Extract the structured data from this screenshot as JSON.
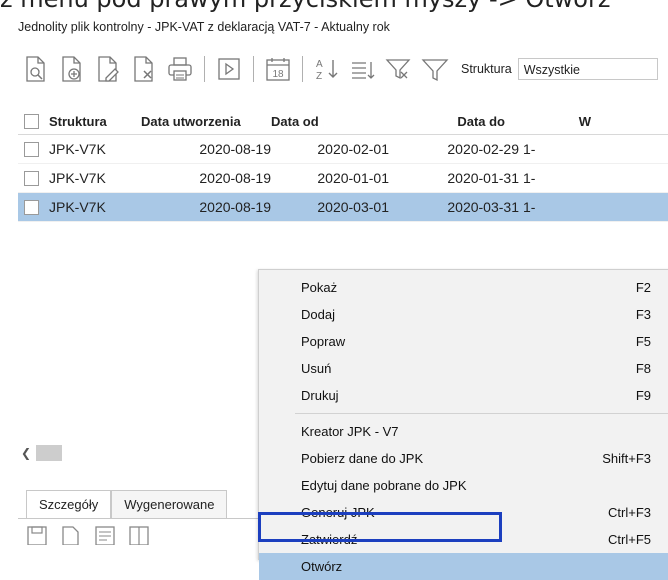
{
  "caption": "z menu pod prawym przyciskiem myszy -> Otwórz",
  "window": {
    "title": "Jednolity plik kontrolny - JPK-VAT z deklaracją VAT-7 - Aktualny rok"
  },
  "toolbar": {
    "icons": [
      "preview-doc-icon",
      "add-doc-icon",
      "edit-doc-icon",
      "delete-doc-icon",
      "print-icon",
      "play-icon",
      "calendar-icon",
      "sort-az-icon",
      "filter-list-icon",
      "filter-clear-icon",
      "filter-icon"
    ],
    "calendar_day": "18",
    "structure_label": "Struktura",
    "structure_value": "Wszystkie"
  },
  "grid": {
    "headers": {
      "structure": "Struktura",
      "created": "Data utworzenia",
      "from": "Data od",
      "to": "Data do",
      "w": "W"
    },
    "rows": [
      {
        "structure": "JPK-V7K",
        "created": "2020-08-19",
        "from": "2020-02-01",
        "to": "2020-02-29",
        "w": "1-"
      },
      {
        "structure": "JPK-V7K",
        "created": "2020-08-19",
        "from": "2020-01-01",
        "to": "2020-01-31",
        "w": "1-"
      },
      {
        "structure": "JPK-V7K",
        "created": "2020-08-19",
        "from": "2020-03-01",
        "to": "2020-03-31",
        "w": "1-"
      }
    ]
  },
  "tabs": [
    "Szczegóły",
    "Wygenerowane"
  ],
  "context_menu": {
    "items": [
      {
        "label": "Pokaż",
        "shortcut": "F2"
      },
      {
        "label": "Dodaj",
        "shortcut": "F3"
      },
      {
        "label": "Popraw",
        "shortcut": "F5"
      },
      {
        "label": "Usuń",
        "shortcut": "F8"
      },
      {
        "label": "Drukuj",
        "shortcut": "F9"
      },
      {
        "label": "Kreator JPK - V7",
        "shortcut": ""
      },
      {
        "label": "Pobierz dane do JPK",
        "shortcut": "Shift+F3"
      },
      {
        "label": "Edytuj dane pobrane do JPK",
        "shortcut": ""
      },
      {
        "label": "Generuj JPK",
        "shortcut": "Ctrl+F3"
      },
      {
        "label": "Zatwierdź",
        "shortcut": "Ctrl+F5"
      },
      {
        "label": "Otwórz",
        "shortcut": ""
      }
    ]
  },
  "colors": {
    "selection": "#a9c8e6",
    "highlight_border": "#1c3fbf"
  }
}
